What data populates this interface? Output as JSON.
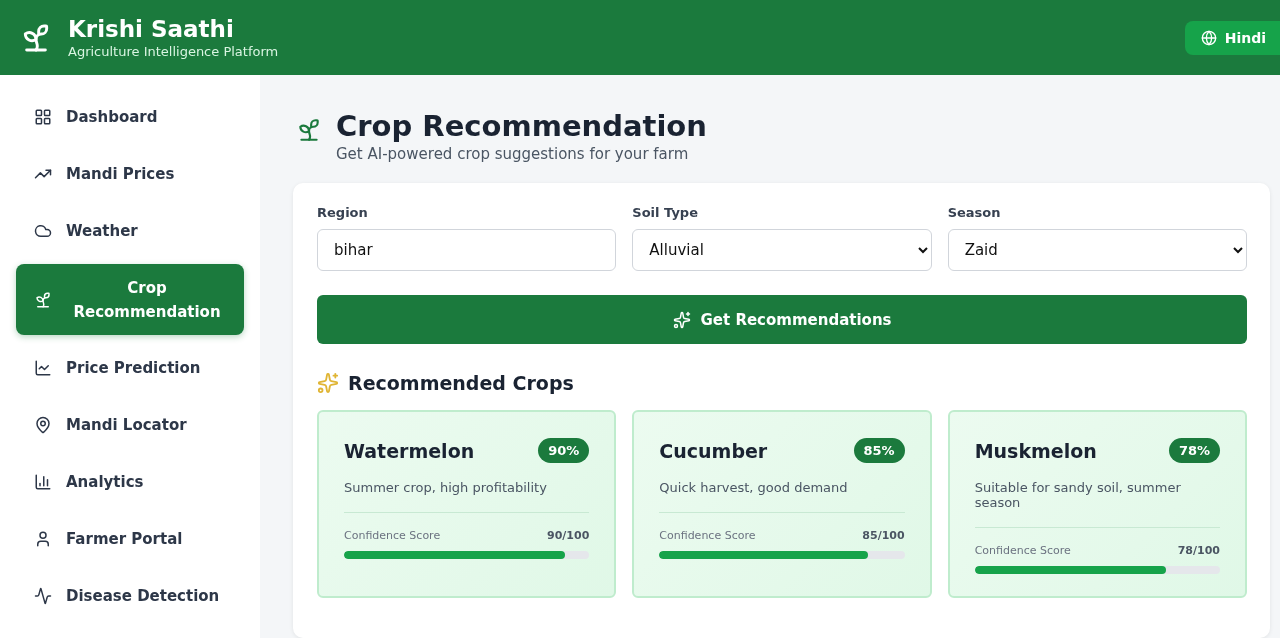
{
  "header": {
    "title": "Krishi Saathi",
    "subtitle": "Agriculture Intelligence Platform",
    "language_button": "Hindi"
  },
  "sidebar": {
    "items": [
      {
        "label": "Dashboard",
        "selected": false
      },
      {
        "label": "Mandi Prices",
        "selected": false
      },
      {
        "label": "Weather",
        "selected": false
      },
      {
        "label": "Crop Recommendation",
        "selected": true
      },
      {
        "label": "Price Prediction",
        "selected": false
      },
      {
        "label": "Mandi Locator",
        "selected": false
      },
      {
        "label": "Analytics",
        "selected": false
      },
      {
        "label": "Farmer Portal",
        "selected": false
      },
      {
        "label": "Disease Detection",
        "selected": false
      }
    ]
  },
  "page": {
    "title": "Crop Recommendation",
    "subtitle": "Get AI-powered crop suggestions for your farm"
  },
  "form": {
    "fields": [
      {
        "kind": "text",
        "label": "Region",
        "value": "bihar"
      },
      {
        "kind": "select",
        "label": "Soil Type",
        "value": "Alluvial"
      },
      {
        "kind": "select",
        "label": "Season",
        "value": "Zaid"
      }
    ],
    "submit": "Get Recommendations"
  },
  "results": {
    "title": "Recommended Crops",
    "crops": [
      {
        "name": "Watermelon",
        "badge": "90%",
        "description": "Summer crop, high profitability",
        "score_label": "Confidence Score",
        "score": "90/100",
        "level": 0.9
      },
      {
        "name": "Cucumber",
        "badge": "85%",
        "description": "Quick harvest, good demand",
        "score_label": "Confidence Score",
        "score": "85/100",
        "level": 0.85
      },
      {
        "name": "Muskmelon",
        "badge": "78%",
        "description": "Suitable for sandy soil, summer season",
        "score_label": "Confidence Score",
        "score": "78/100",
        "level": 0.78
      }
    ]
  }
}
